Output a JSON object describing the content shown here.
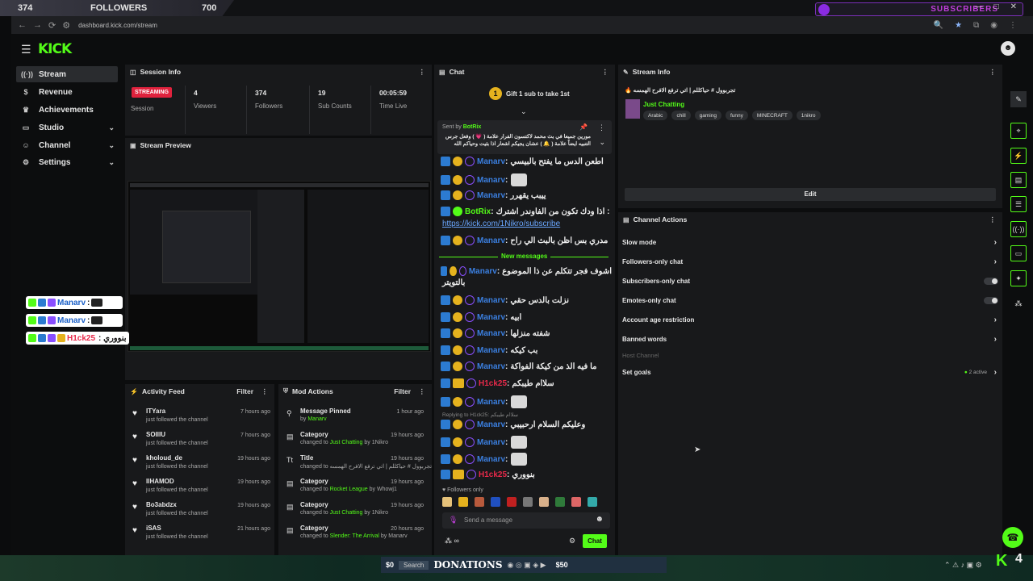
{
  "overlay": {
    "followers_count": "374",
    "followers_label": "FOLLOWERS",
    "followers_goal": "700",
    "subscribers_label": "SUBSCRIBERS"
  },
  "browser": {
    "url": "dashboard.kick.com/stream",
    "win_controls": [
      "—",
      "□",
      "✕"
    ]
  },
  "app": {
    "logo": "KICK"
  },
  "sidebar": {
    "items": [
      {
        "label": "Stream",
        "icon": "stream-icon",
        "active": true
      },
      {
        "label": "Revenue",
        "icon": "dollar-icon"
      },
      {
        "label": "Achievements",
        "icon": "trophy-icon"
      },
      {
        "label": "Studio",
        "icon": "video-icon",
        "chevron": true
      },
      {
        "label": "Channel",
        "icon": "user-icon",
        "chevron": true
      },
      {
        "label": "Settings",
        "icon": "gear-icon",
        "chevron": true
      }
    ]
  },
  "session": {
    "title": "Session Info",
    "status_badge": "STREAMING",
    "status_label": "Session",
    "stats": [
      {
        "value": "4",
        "label": "Viewers"
      },
      {
        "value": "374",
        "label": "Followers"
      },
      {
        "value": "19",
        "label": "Sub Counts"
      },
      {
        "value": "00:05:59",
        "label": "Time Live"
      }
    ]
  },
  "preview": {
    "title": "Stream Preview"
  },
  "preview_chat": [
    {
      "user": "Manarv",
      "text": ":"
    },
    {
      "user": "Manarv",
      "text": ":"
    },
    {
      "user": "H1ck25",
      "text": ": بنووري"
    }
  ],
  "activity": {
    "title": "Activity Feed",
    "filter": "Filter",
    "items": [
      {
        "name": "ITYara",
        "sub": "just followed the channel",
        "time": "7 hours ago"
      },
      {
        "name": "SOIIIU",
        "sub": "just followed the channel",
        "time": "7 hours ago"
      },
      {
        "name": "kholoud_de",
        "sub": "just followed the channel",
        "time": "19 hours ago"
      },
      {
        "name": "IIHAMOD",
        "sub": "just followed the channel",
        "time": "19 hours ago"
      },
      {
        "name": "Bo3abdzx",
        "sub": "just followed the channel",
        "time": "19 hours ago"
      },
      {
        "name": "iSAS",
        "sub": "just followed the channel",
        "time": "21 hours ago"
      }
    ]
  },
  "mod": {
    "title": "Mod Actions",
    "filter": "Filter",
    "items": [
      {
        "icon": "pin-icon",
        "title": "Message Pinned",
        "pre": "by ",
        "hl": "Manarv",
        "post": "",
        "time": "1 hour ago"
      },
      {
        "icon": "category-icon",
        "title": "Category",
        "pre": "changed to ",
        "hl": "Just Chatting",
        "post": " by 1Nikro",
        "time": "19 hours ago"
      },
      {
        "icon": "title-icon",
        "title": "Title",
        "pre": "changed to ",
        "hl": "",
        "post": "تجربوول # حياكللم | اتي ترفع الافرح الهمسه 🔥",
        "time": "19 hours ago"
      },
      {
        "icon": "category-icon",
        "title": "Category",
        "pre": "changed to ",
        "hl": "Rocket League",
        "post": " by Whowj1",
        "time": "19 hours ago"
      },
      {
        "icon": "category-icon",
        "title": "Category",
        "pre": "changed to ",
        "hl": "Just Chatting",
        "post": " by 1Nikro",
        "time": "19 hours ago"
      },
      {
        "icon": "category-icon",
        "title": "Category",
        "pre": "changed to ",
        "hl": "Slender: The Arrival",
        "post": " by Manarv",
        "time": "20 hours ago"
      }
    ]
  },
  "chat": {
    "title": "Chat",
    "gift_count": "1",
    "gift_text": "Gift 1 sub to take 1st",
    "pinned_by": "Sent by",
    "pinned_user": "BotRix",
    "pinned_text": "مورين جميعا في بث محمد لاكتسون الفرار علامة ( 💗 ) وفعل جرس التنبيه ايضاً علامة ( 🔔 ) عشان يجيكم اشعار اذا بثيت وحياكم الله",
    "new_messages": "New messages",
    "reply_hint": "Replying to H1ck25: سلاام طيبكم",
    "followers_only": "Followers only",
    "placeholder": "Send a message",
    "send": "Chat",
    "messages": [
      {
        "user": "Manarv",
        "text": "اطعن الدس ما يفتح بالبيسي"
      },
      {
        "user": "Manarv",
        "text": "",
        "emote": true
      },
      {
        "user": "Manarv",
        "text": "ييبب يقهرر"
      },
      {
        "user": "BotRix",
        "text": "اذا ودك تكون من الفاوندر اشترك :",
        "link": "https://kick.com/1Nikro/subscribe",
        "bot": true
      },
      {
        "user": "Manarv",
        "text": "مدري بس اظن بالبث الي راح"
      },
      {
        "user": "Manarv",
        "text": "اشوف فجر تتكلم عن ذا الموضوع",
        "text2": "بالتويتر"
      },
      {
        "user": "Manarv",
        "text": "نزلت بالدس حقي"
      },
      {
        "user": "Manarv",
        "text": "ابيه"
      },
      {
        "user": "Manarv",
        "text": "شفته منزلها"
      },
      {
        "user": "Manarv",
        "text": "بب كيكه"
      },
      {
        "user": "Manarv",
        "text": "ما فيه الذ من كيكة الفواكة"
      },
      {
        "user": "H1ck25",
        "text": "سلاام طيبكم",
        "red": true
      },
      {
        "user": "Manarv",
        "text": "",
        "emote": true
      },
      {
        "user": "Manarv",
        "text": "وعليكم السلام ارحبيبي"
      },
      {
        "user": "Manarv",
        "text": "",
        "emote": true
      },
      {
        "user": "Manarv",
        "text": "",
        "emote": true
      },
      {
        "user": "H1ck25",
        "text": "بنووري",
        "red": true
      }
    ]
  },
  "stream_info": {
    "title": "Stream Info",
    "stream_title": "تجربوول # حياكللم | اتي ترفع الافرح الهمسه 🔥",
    "category": "Just Chatting",
    "tags": [
      "Arabic",
      "chill",
      "gaming",
      "funny",
      "MINECRAFT",
      "1nikro"
    ],
    "edit": "Edit"
  },
  "channel_actions": {
    "title": "Channel Actions",
    "items": [
      {
        "label": "Slow mode",
        "control": "chevron"
      },
      {
        "label": "Followers-only chat",
        "control": "chevron"
      },
      {
        "label": "Subscribers-only chat",
        "control": "toggle"
      },
      {
        "label": "Emotes-only chat",
        "control": "toggle"
      },
      {
        "label": "Account age restriction",
        "control": "chevron"
      },
      {
        "label": "Banned words",
        "control": "chevron"
      }
    ],
    "host_channel": "Host Channel",
    "set_goals": "Set goals",
    "goals_status": "2 active"
  },
  "taskbar": {
    "search": "Search",
    "donations": "DONATIONS",
    "donation_amount_1": "$0",
    "donation_amount_2": "$50",
    "kick_count": "4"
  },
  "colors": {
    "accent": "#53fc18",
    "streaming": "#e0223d",
    "username": "#3b7fe0",
    "mod_red": "#e8294a"
  }
}
